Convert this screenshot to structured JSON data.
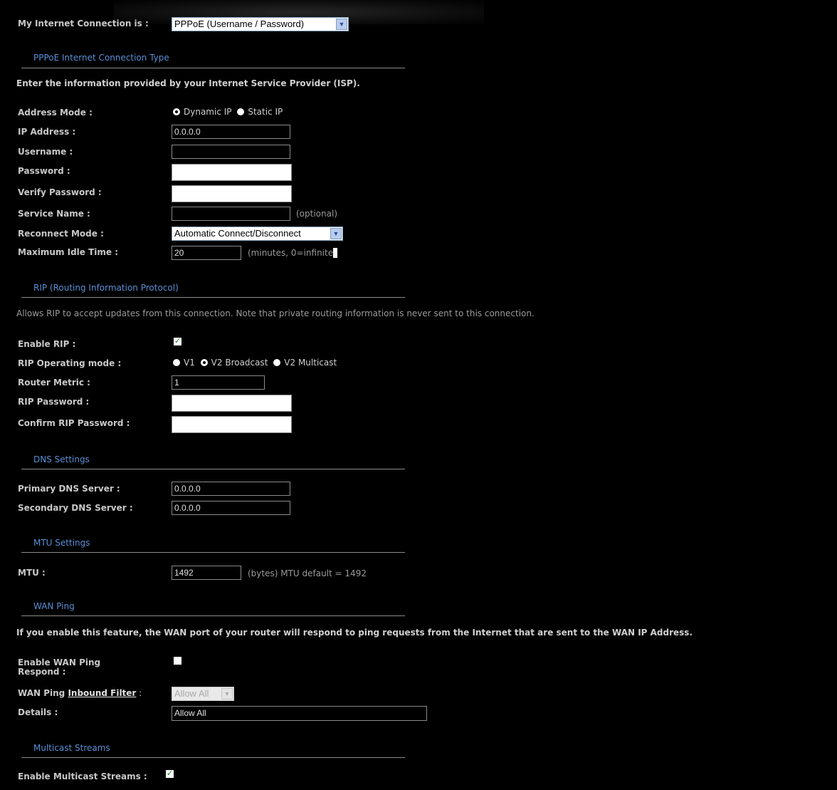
{
  "connection": {
    "label": "My Internet Connection is :",
    "selected": "PPPoE (Username / Password)"
  },
  "pppoe": {
    "section_title": "PPPoE Internet Connection Type",
    "description": "Enter the information provided by your Internet Service Provider (ISP).",
    "address_mode_label": "Address Mode :",
    "address_mode_options": [
      "Dynamic IP",
      "Static IP"
    ],
    "address_mode_selected": "Dynamic IP",
    "ip_label": "IP Address :",
    "ip_value": "0.0.0.0",
    "username_label": "Username :",
    "username_value": "",
    "password_label": "Password :",
    "verify_password_label": "Verify Password :",
    "service_name_label": "Service Name :",
    "service_name_value": "",
    "service_name_hint": "(optional)",
    "reconnect_label": "Reconnect Mode :",
    "reconnect_selected": "Automatic Connect/Disconnect",
    "idle_label": "Maximum Idle Time :",
    "idle_value": "20",
    "idle_hint": "(minutes, 0=infinite"
  },
  "rip": {
    "section_title": "RIP (Routing Information Protocol)",
    "description": "Allows RIP to accept updates from this connection. Note that private routing information is never sent to this connection.",
    "enable_label": "Enable RIP :",
    "enable_checked": true,
    "mode_label": "RIP Operating mode :",
    "mode_options": [
      "V1",
      "V2 Broadcast",
      "V2 Multicast"
    ],
    "mode_selected": "V2 Broadcast",
    "metric_label": "Router Metric :",
    "metric_value": "1",
    "password_label": "RIP Password :",
    "confirm_label": "Confirm RIP Password :"
  },
  "dns": {
    "section_title": "DNS Settings",
    "primary_label": "Primary DNS Server :",
    "primary_value": "0.0.0.0",
    "secondary_label": "Secondary DNS Server :",
    "secondary_value": "0.0.0.0"
  },
  "mtu": {
    "section_title": "MTU Settings",
    "label": "MTU :",
    "value": "1492",
    "hint": "(bytes) MTU default = 1492"
  },
  "wan_ping": {
    "section_title": "WAN Ping",
    "description": "If you enable this feature, the WAN port of your router will respond to ping requests from the Internet that are sent to the WAN IP Address.",
    "enable_label_line1": "Enable WAN Ping",
    "enable_label_line2": "Respond :",
    "enable_checked": false,
    "filter_label_prefix": "WAN Ping",
    "filter_label_link": "Inbound Filter",
    "filter_label_suffix": " :",
    "filter_selected": "Allow All",
    "details_label": "Details :",
    "details_value": "Allow All"
  },
  "multicast": {
    "section_title": "Multicast Streams",
    "enable_label": "Enable Multicast Streams :",
    "enable_checked": true
  }
}
